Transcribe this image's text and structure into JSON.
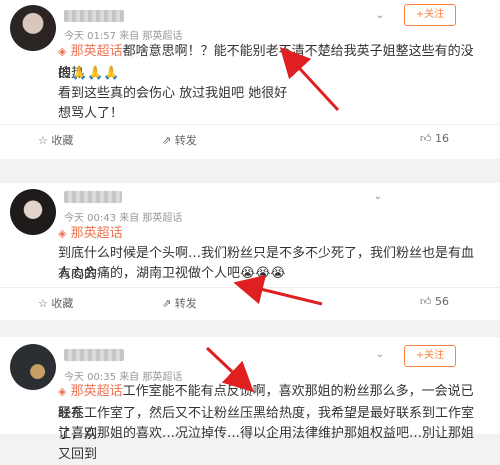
{
  "posts": [
    {
      "time": "今天 01:57",
      "source": "来自 那英超话",
      "follow": "+关注",
      "topic": "那英超话",
      "text1": "都啥意思啊！？能不能别老不清不楚给我英子姐整这些有的没的热",
      "text2": "搜🙏🙏🙏",
      "text3": "看到这些真的会伤心 放过我姐吧 她很好",
      "text4": "想骂人了！",
      "actions": {
        "fav": "收藏",
        "share": "转发",
        "like": "16"
      }
    },
    {
      "time": "今天 00:43",
      "source": "来自 那英超话",
      "topic": "那英超话",
      "text1": "到底什么时候是个头啊…我们粉丝只是不多不少死了，我们粉丝也是有血有肉的",
      "text2": "人心会痛的，湖南卫视做个人吧😭😭😭",
      "actions": {
        "fav": "收藏",
        "share": "转发",
        "like": "56"
      }
    },
    {
      "time": "今天 00:35",
      "source": "来自 那英超话",
      "follow": "+关注",
      "topic": "那英超话",
      "text1": "工作室能不能有点反馈啊，喜欢那姐的粉丝那么多，一会说已经在",
      "text2": "联系工作室了，然后又不让粉丝压黑给热度，我希望是最好联系到工作室了，别",
      "text3": "让喜欢那姐的喜欢…况泣掉传…得以企用法律维护那姐权益吧…別让那姐又回到"
    }
  ],
  "icons": {
    "dropdown": "chevron-down",
    "topic": "diamond",
    "fav": "star",
    "share": "share",
    "like": "thumb-up"
  },
  "colors": {
    "accent": "#ff8140",
    "topic": "#eb7350",
    "arrow": "#e02020"
  }
}
